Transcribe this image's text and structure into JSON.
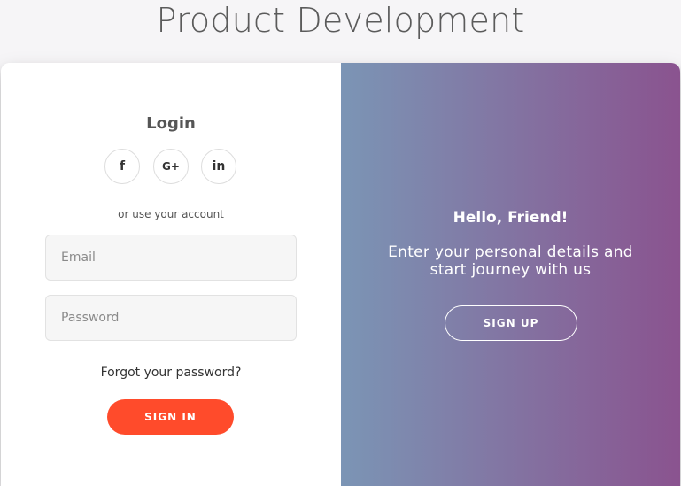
{
  "page": {
    "title": "Product Development"
  },
  "signin": {
    "heading": "Login",
    "social": [
      {
        "icon": "facebook-icon",
        "glyph": "f"
      },
      {
        "icon": "google-plus-icon",
        "glyph": "G+"
      },
      {
        "icon": "linkedin-icon",
        "glyph": "in"
      }
    ],
    "or_text": "or use your account",
    "email_placeholder": "Email",
    "password_placeholder": "Password",
    "forgot": "Forgot your password?",
    "button": "SIGN IN"
  },
  "overlay": {
    "title": "Hello, Friend!",
    "text": "Enter your personal details and start journey with us",
    "button": "SIGN UP"
  },
  "colors": {
    "accent": "#ff4b2b",
    "gradient_start": "#7b95b5",
    "gradient_end": "#8a538f"
  }
}
